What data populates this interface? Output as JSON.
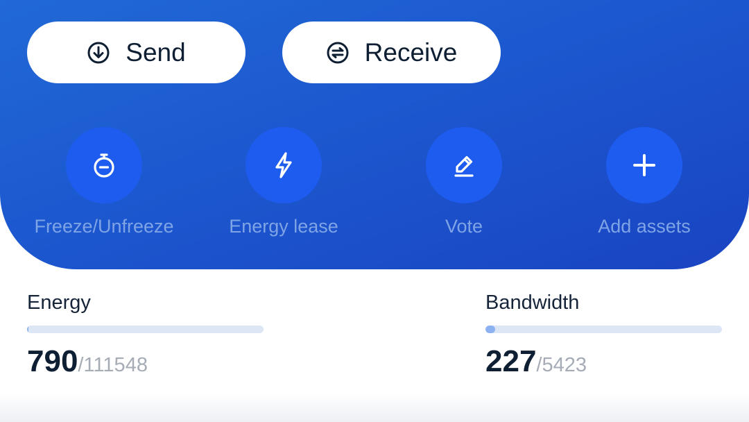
{
  "top_buttons": {
    "send": {
      "label": "Send",
      "icon": "arrow-down-circle-icon"
    },
    "receive": {
      "label": "Receive",
      "icon": "swap-circle-icon"
    }
  },
  "actions": [
    {
      "label": "Freeze/Unfreeze",
      "icon": "stopwatch-icon"
    },
    {
      "label": "Energy lease",
      "icon": "lightning-icon"
    },
    {
      "label": "Vote",
      "icon": "pencil-icon"
    },
    {
      "label": "Add assets",
      "icon": "plus-icon"
    }
  ],
  "resources": {
    "energy": {
      "title": "Energy",
      "current": "790",
      "total": "/111548",
      "fill_fraction": 0.007
    },
    "bandwidth": {
      "title": "Bandwidth",
      "current": "227",
      "total": "/5423",
      "fill_fraction": 0.042
    }
  },
  "colors": {
    "hero_gradient": [
      "#2169d6",
      "#1a44c2"
    ],
    "action_circle": "#1e5cf0",
    "action_label": "#7fa4e6",
    "bar_track": "#dde6f5",
    "bar_fill": "#8db2f2"
  }
}
